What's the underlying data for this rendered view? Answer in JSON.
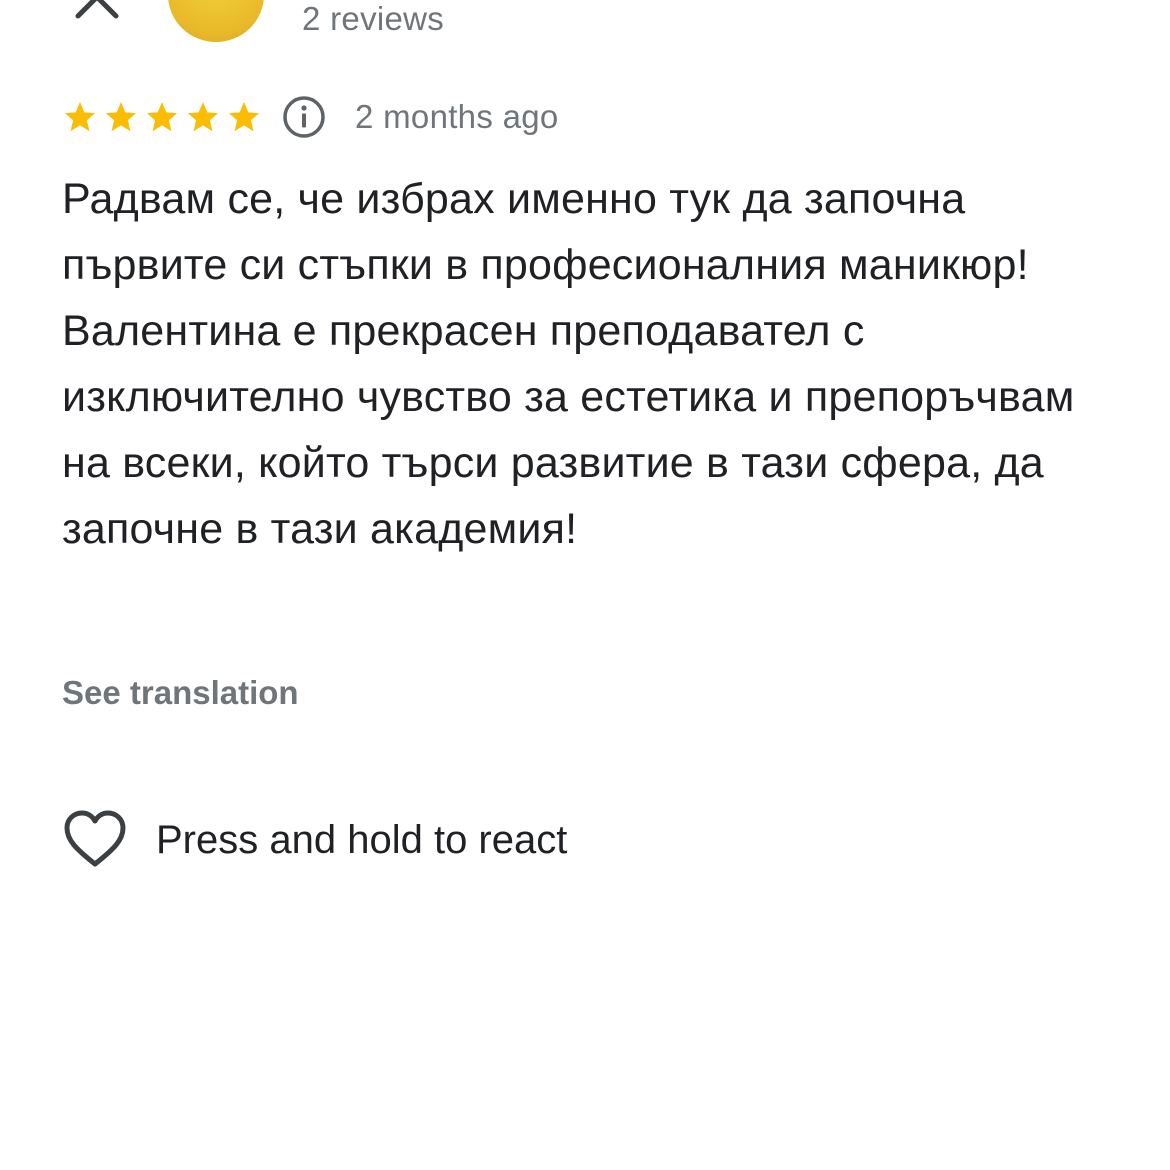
{
  "header": {
    "close_icon": "close-icon",
    "reviewer": {
      "reviews_count": "2 reviews",
      "avatar_color": "#e8b92a"
    }
  },
  "rating": {
    "stars": 5,
    "max_stars": 5,
    "star_color": "#fbbc04",
    "info_icon": "info-icon",
    "time_ago": "2 months ago"
  },
  "review": {
    "text": "Радвам се, че избрах именно тук да започна първите си стъпки в професионалния маникюр! Валентина е прекрасен преподавател с изключително чувство за естетика и препоръчвам на всеки, който търси развитие в тази сфера, да започне в тази академия!",
    "see_translation_label": "See translation"
  },
  "reaction": {
    "icon": "heart-outline-icon",
    "label": "Press and hold to react"
  }
}
